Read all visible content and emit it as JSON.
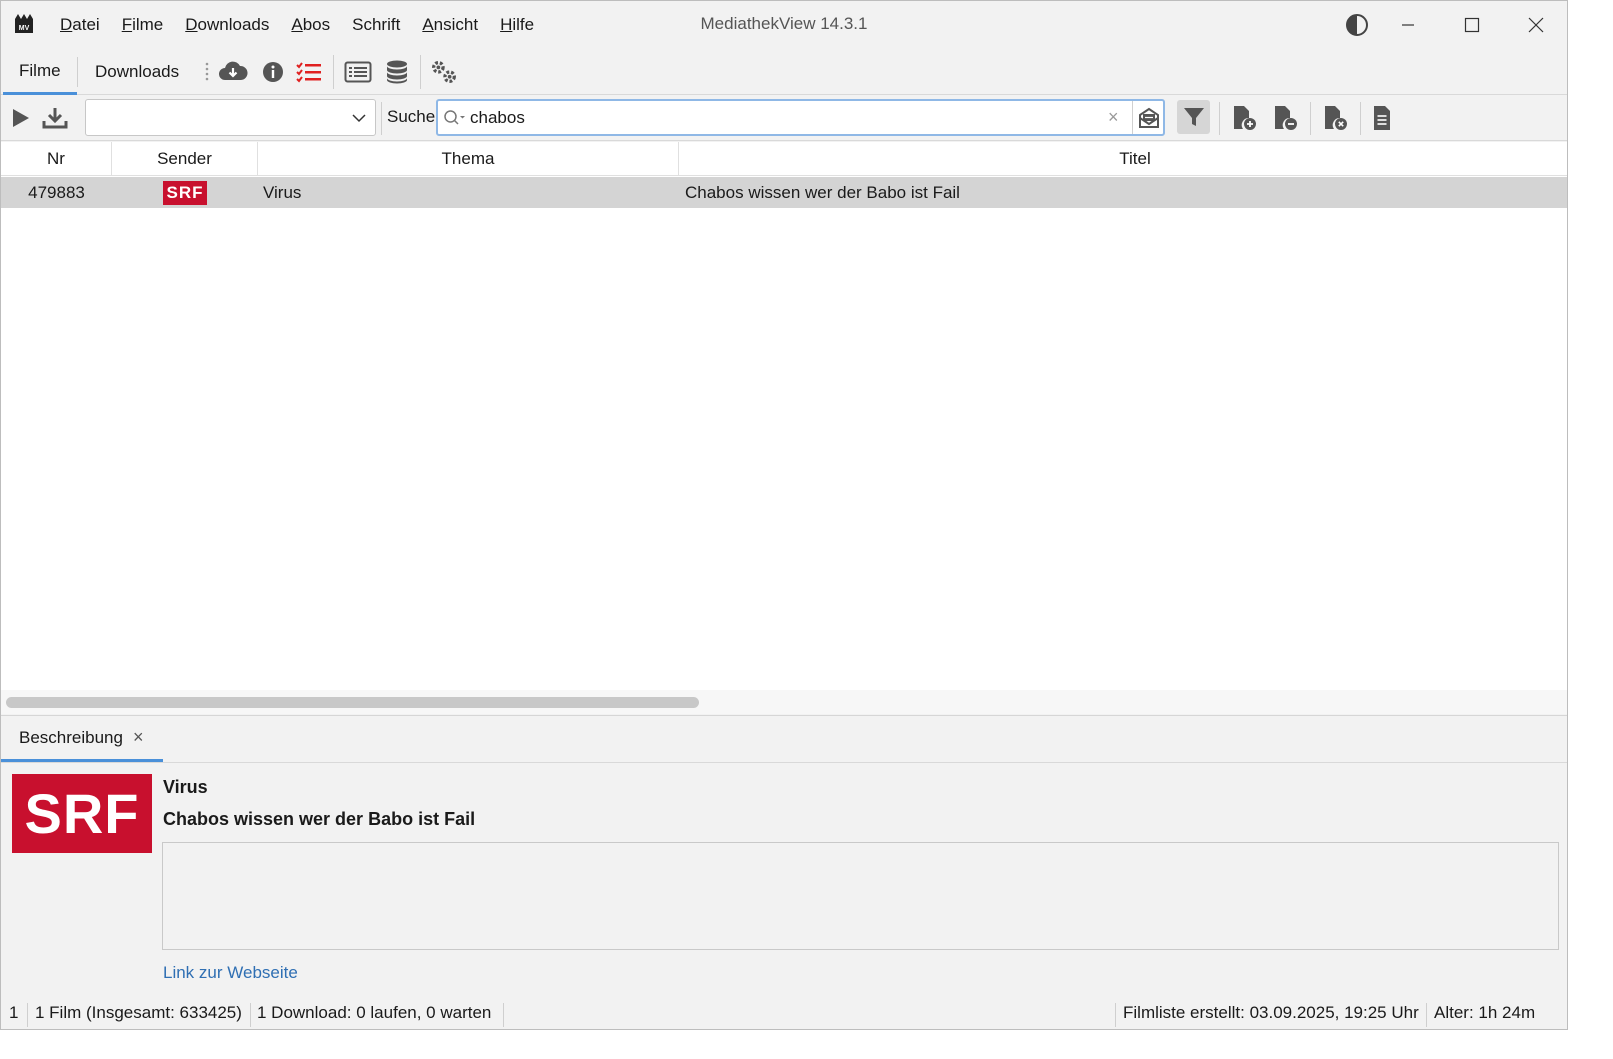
{
  "app": {
    "title": "MediathekView 14.3.1"
  },
  "menu": {
    "items": [
      {
        "accel": "D",
        "rest": "atei"
      },
      {
        "accel": "F",
        "rest": "ilme"
      },
      {
        "accel": "D",
        "rest": "ownloads"
      },
      {
        "accel": "A",
        "rest": "bos"
      },
      {
        "accel": "",
        "rest": "Schrift"
      },
      {
        "accel": "A",
        "rest": "nsicht"
      },
      {
        "accel": "H",
        "rest": "ilfe"
      }
    ]
  },
  "tabs": {
    "filme": "Filme",
    "downloads": "Downloads"
  },
  "search": {
    "label": "Suche:",
    "value": "chabos",
    "clear": "×"
  },
  "table": {
    "columns": {
      "nr": "Nr",
      "sender": "Sender",
      "thema": "Thema",
      "titel": "Titel"
    },
    "rows": [
      {
        "nr": "479883",
        "sender": "SRF",
        "thema": "Virus",
        "titel": "Chabos wissen wer der Babo ist Fail"
      }
    ]
  },
  "description": {
    "tab_label": "Beschreibung",
    "close": "×",
    "sender_logo": "SRF",
    "topic": "Virus",
    "title": "Chabos wissen wer der Babo ist Fail",
    "text": "",
    "link": "Link zur Webseite"
  },
  "status": {
    "selected": "1",
    "films": "1 Film (Insgesamt: 633425)",
    "downloads": "1 Download: 0 laufen, 0 warten",
    "filmlist": "Filmliste erstellt: 03.09.2025, 19:25 Uhr",
    "age": "Alter: 1h 24m"
  },
  "colors": {
    "accent": "#4a90d9",
    "srf_red": "#c8102e",
    "selection": "#d4d4d4",
    "link": "#2f6fb3",
    "alert_icon": "#e02020"
  },
  "icons": {
    "toolbar": [
      "cloud-download-icon",
      "info-icon",
      "checklist-icon",
      "list-view-icon",
      "database-icon",
      "settings-icon"
    ],
    "search_toolbar": [
      "play-icon",
      "download-icon",
      "search-icon",
      "search-mode-icon",
      "filter-icon",
      "file-add-icon",
      "file-remove-icon",
      "file-delete-icon",
      "document-icon"
    ]
  }
}
